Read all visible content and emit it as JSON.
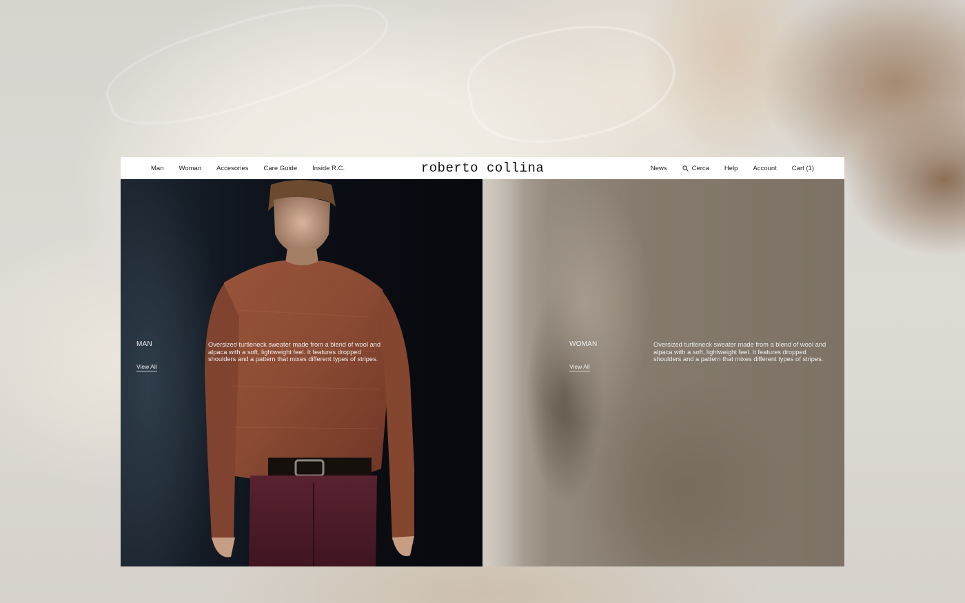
{
  "brand": {
    "logo": "roberto collina"
  },
  "nav_left": [
    {
      "label": "Man"
    },
    {
      "label": "Woman"
    },
    {
      "label": "Accesories"
    },
    {
      "label": "Care Guide"
    },
    {
      "label": "Inside R.C."
    }
  ],
  "nav_right": {
    "news": "News",
    "search": "Cerca",
    "help": "Help",
    "account": "Account",
    "cart": "Cart (1)"
  },
  "panels": {
    "man": {
      "title": "MAN",
      "link": "View All",
      "description": "Oversized turtleneck sweater made from a blend of wool and alpaca with a soft, lightweight feel. It features dropped shoulders and a pattern that mixes different types of stripes."
    },
    "woman": {
      "title": "WOMAN",
      "link": "View All",
      "description": "Oversized turtleneck sweater made from a blend of wool and alpaca with a soft, lightweight feel. It features dropped shoulders and a pattern that mixes different types of stripes."
    }
  },
  "icons": {
    "search": "search-icon"
  },
  "colors": {
    "accent_text": "#eeeeee",
    "nav_text": "#222222",
    "sweater": "#8a4a33"
  }
}
